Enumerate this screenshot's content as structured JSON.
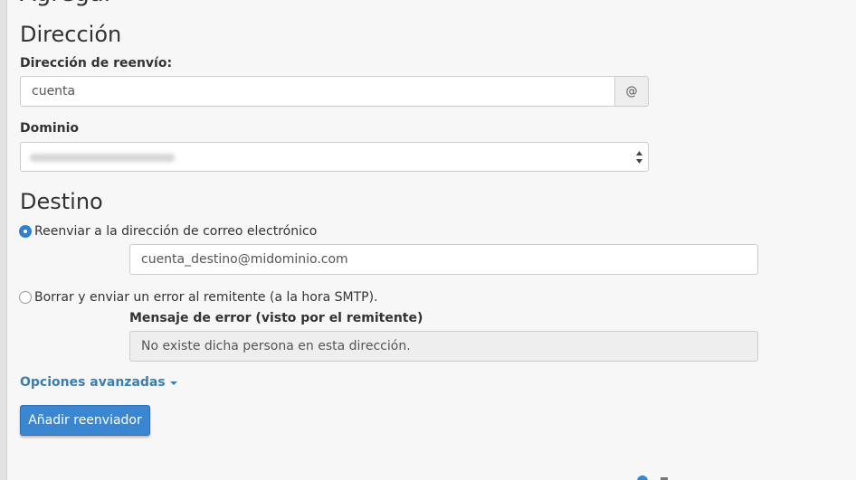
{
  "page": {
    "cut_heading": "Agregar"
  },
  "address": {
    "title": "Dirección",
    "forward_label": "Dirección de reenvío:",
    "forward_value": "cuenta",
    "at_symbol": "@",
    "domain_label": "Dominio"
  },
  "destination": {
    "title": "Destino",
    "forward_option_label": "Reenviar a la dirección de correo electrónico",
    "forward_option_checked": true,
    "destination_value": "cuenta_destino@midominio.com",
    "fail_option_label": "Borrar y enviar un error al remitente (a la hora SMTP).",
    "fail_option_checked": false,
    "error_message_label": "Mensaje de error (visto por el remitente)",
    "error_message_value": "No existe dicha persona en esta dirección."
  },
  "actions": {
    "advanced_options_label": "Opciones avanzadas",
    "submit_label": "Añadir reenviador"
  },
  "colors": {
    "primary": "#3a86d0",
    "link": "#3a7fb0",
    "background": "#f7f7f7"
  }
}
